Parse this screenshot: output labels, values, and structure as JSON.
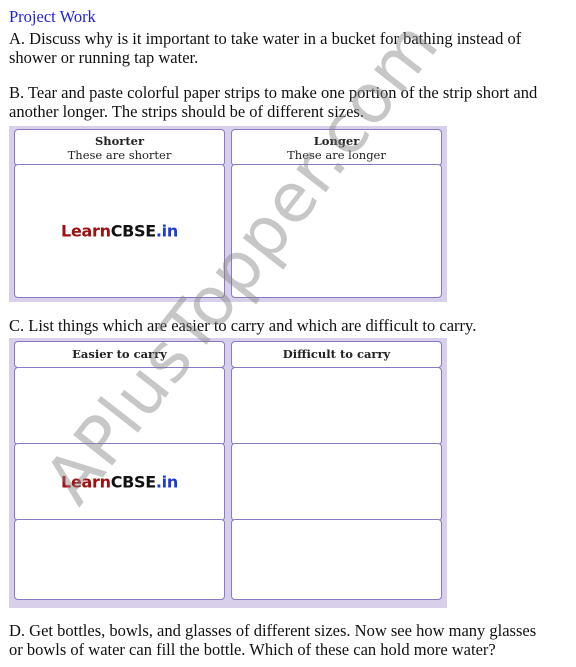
{
  "title": "Project Work",
  "questions": {
    "a": [
      "A. Discuss why is it important to take water in a bucket for bathing instead of",
      "shower or running tap water."
    ],
    "b": [
      "B. Tear and paste colorful paper strips to make one portion of the strip short and",
      "another longer. The strips should be of different sizes."
    ],
    "c": [
      "C. List things which are easier to carry and which are difficult to carry."
    ],
    "d": [
      "D. Get bottles, bowls, and glasses of different sizes. Now see how many glasses",
      "or bowls of water can fill the bottle. Which of these can hold more water?"
    ]
  },
  "table_b": {
    "columns": [
      {
        "heading": "Shorter",
        "subheading": "These are shorter"
      },
      {
        "heading": "Longer",
        "subheading": "These are longer"
      }
    ]
  },
  "table_c": {
    "columns": [
      {
        "heading": "Easier to carry"
      },
      {
        "heading": "Difficult to carry"
      }
    ],
    "rows": 3
  },
  "logo": {
    "part1": "Learn",
    "part2": "CBSE",
    "part3": ".in"
  },
  "watermark": "APlusTopper.com",
  "colors": {
    "title": "#1f1fe0",
    "panel": "#d8d0ea",
    "border": "#8a78c4",
    "logo_red": "#a01010",
    "logo_blue": "#1d3bd8"
  }
}
